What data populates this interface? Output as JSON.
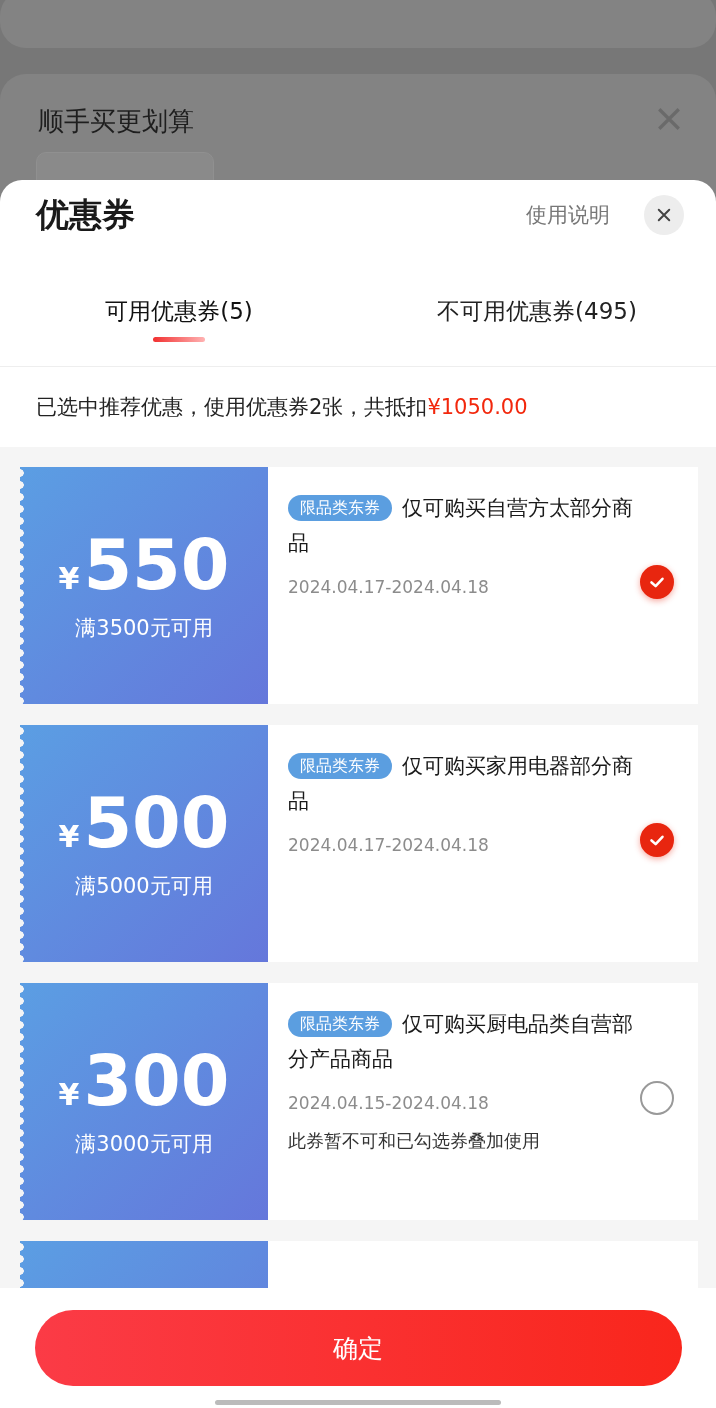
{
  "background": {
    "section_title": "顺手买更划算"
  },
  "sheet": {
    "title": "优惠券",
    "help_link": "使用说明"
  },
  "tabs": [
    {
      "label": "可用优惠券(5)",
      "selected": true
    },
    {
      "label": "不可用优惠券(495)",
      "selected": false
    }
  ],
  "summary": {
    "text": "已选中推荐优惠，使用优惠券2张，共抵扣",
    "amount": "¥1050.00"
  },
  "coupons": [
    {
      "currency": "¥",
      "value": "550",
      "condition": "满3500元可用",
      "tag": "限品类东券",
      "title": "仅可购买自营方太部分商品",
      "dates": "2024.04.17-2024.04.18",
      "selected": true
    },
    {
      "currency": "¥",
      "value": "500",
      "condition": "满5000元可用",
      "tag": "限品类东券",
      "title": "仅可购买家用电器部分商品",
      "dates": "2024.04.17-2024.04.18",
      "selected": true
    },
    {
      "currency": "¥",
      "value": "300",
      "condition": "满3000元可用",
      "tag": "限品类东券",
      "title": "仅可购买厨电品类自营部分产品商品",
      "dates": "2024.04.15-2024.04.18",
      "note": "此券暂不可和已勾选券叠加使用",
      "selected": false
    }
  ],
  "confirm_button": "确定"
}
